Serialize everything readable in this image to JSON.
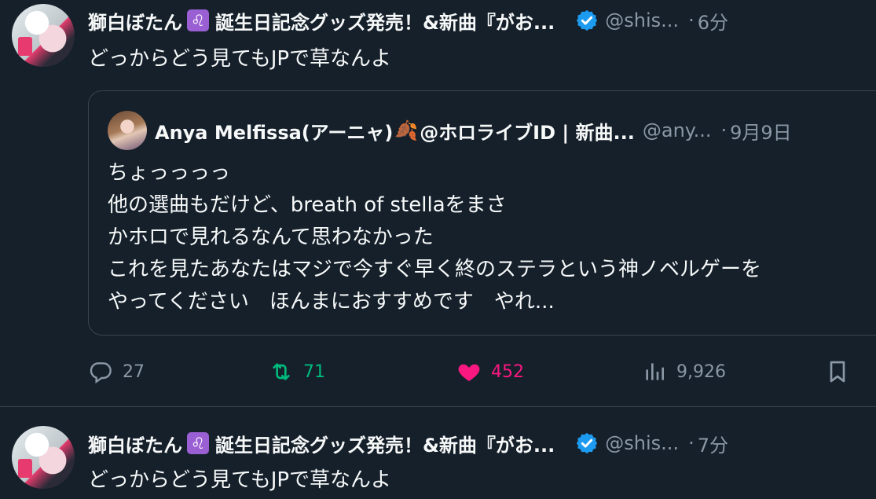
{
  "tweets": [
    {
      "name": "獅白ぼたん",
      "name_suffix": "誕生日記念グッズ発売！&新曲『がお...",
      "handle": "@shis...",
      "dot": "·",
      "time": "6分",
      "text": "どっからどう見てもJPで草なんよ",
      "quote": {
        "name": "Anya Melfissa(アーニャ)",
        "name_suffix": "@ホロライブID | 新曲...",
        "handle": "@any...",
        "dot": "·",
        "time": "9月9日",
        "lines": [
          "ちょっっっっ",
          "他の選曲もだけど、breath of stellaをまさ",
          "かホロで見れるなんて思わなかった",
          "これを見たあなたはマジで今すぐ早く終のステラという神ノベルゲーを",
          "やってください　ほんまにおすすめです　やれ..."
        ]
      },
      "actions": {
        "replies": "27",
        "retweets": "71",
        "likes": "452",
        "views": "9,926"
      }
    },
    {
      "name": "獅白ぼたん",
      "name_suffix": "誕生日記念グッズ発売！&新曲『がお...",
      "handle": "@shis...",
      "dot": "·",
      "time": "7分",
      "text": "どっからどう見てもJPで草なんよ"
    }
  ],
  "colors": {
    "background": "#15202b",
    "text": "#f7f9f9",
    "muted": "#8b98a5",
    "verified": "#1d9bf0",
    "retweet": "#00ba7c",
    "like": "#f91880",
    "leo_badge": "#9a5fd2"
  },
  "icons": {
    "leo": "♌",
    "leaf": "🍂"
  }
}
